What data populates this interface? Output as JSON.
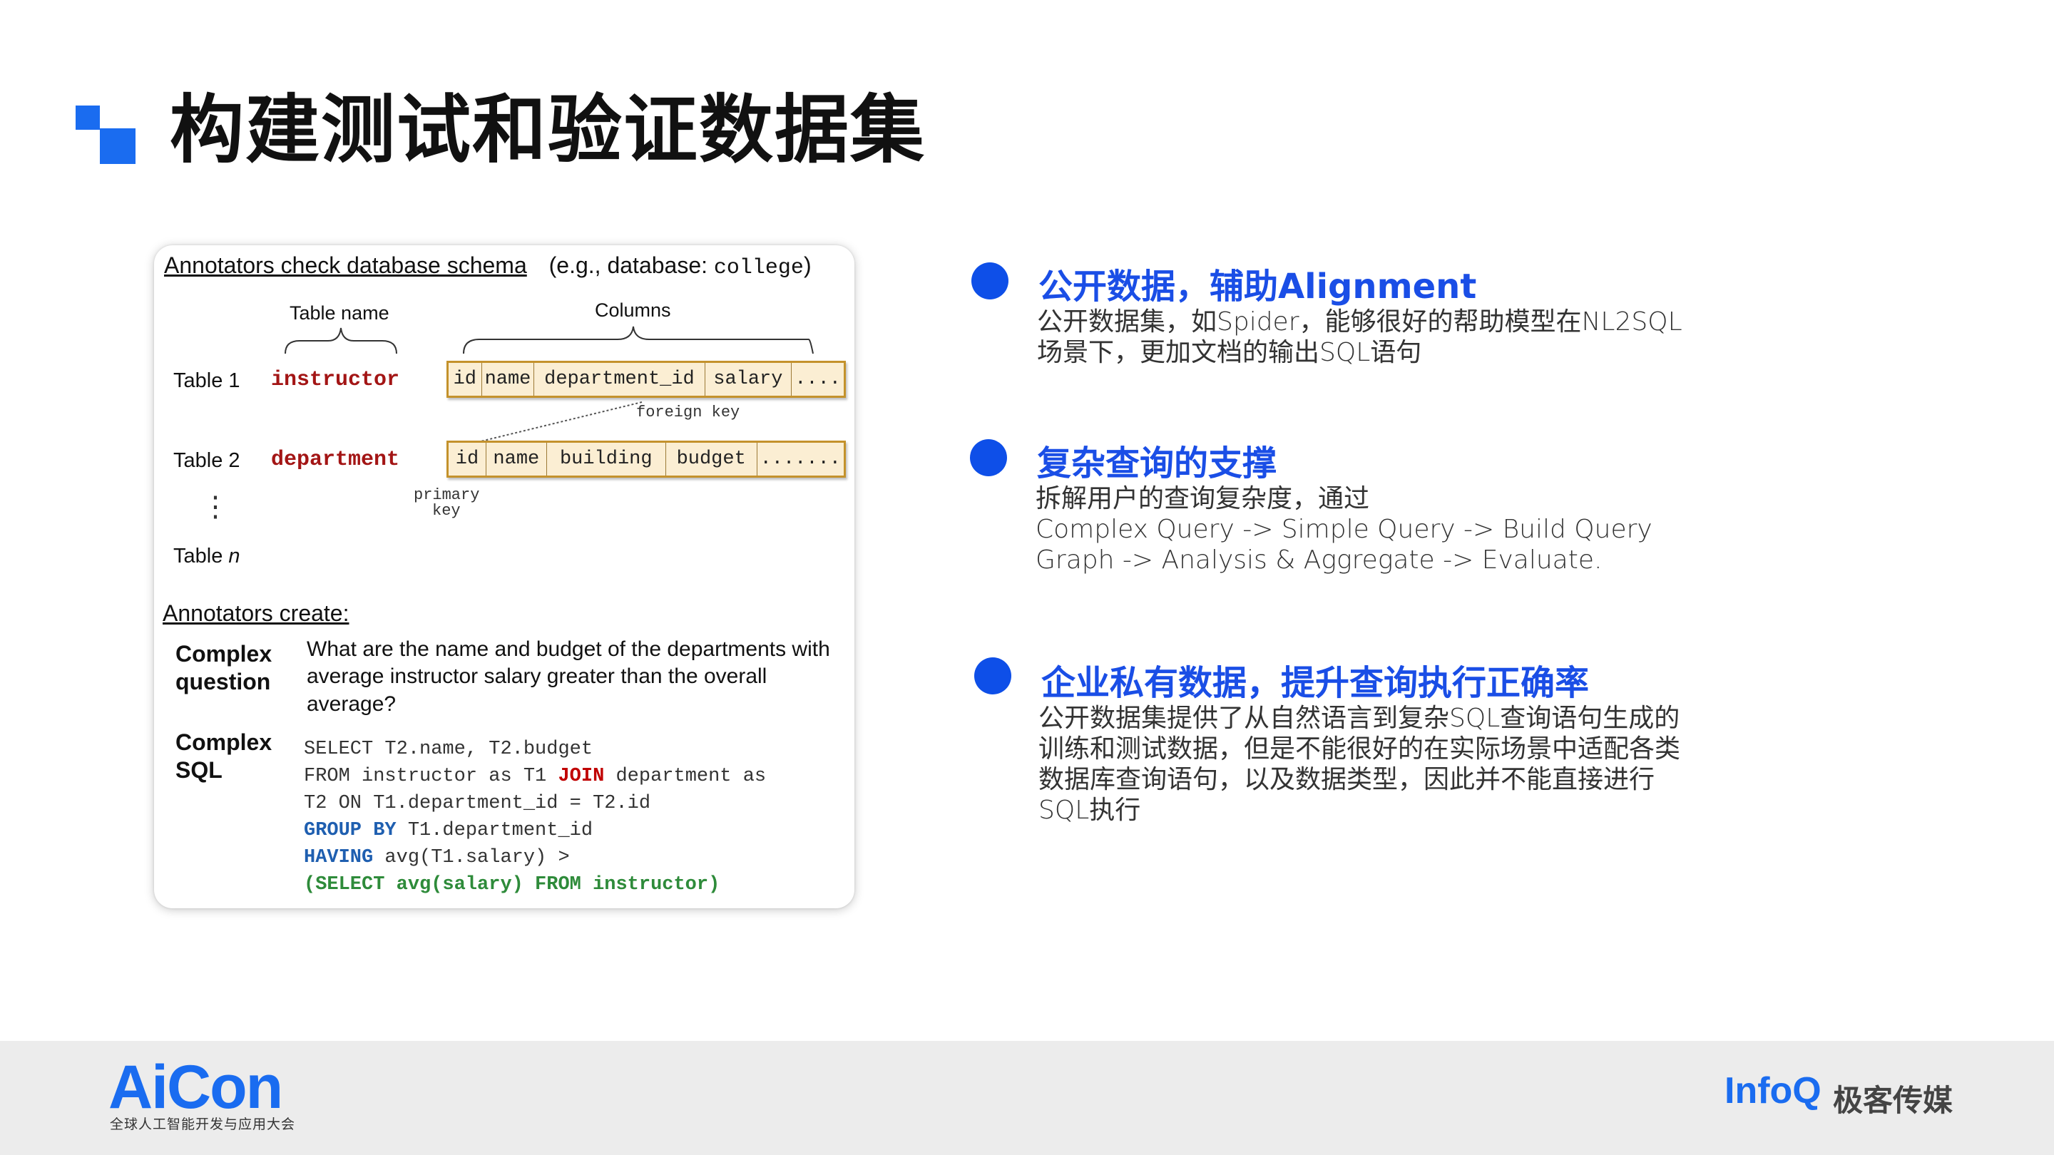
{
  "title": "构建测试和验证数据集",
  "figure": {
    "header": "Annotators check database schema",
    "header_example_prefix": "(e.g., database: ",
    "header_example_db": "college",
    "header_example_suffix": ")",
    "table_name_label": "Table name",
    "columns_label": "Columns",
    "tables": [
      {
        "label": "Table 1",
        "name": "instructor",
        "columns": [
          "id",
          "name",
          "department_id",
          "salary",
          "...."
        ]
      },
      {
        "label": "Table 2",
        "name": "department",
        "columns": [
          "id",
          "name",
          "building",
          "budget",
          "......."
        ]
      }
    ],
    "table_n_prefix": "Table ",
    "table_n_var": "n",
    "foreign_key_label": "foreign key",
    "primary_key_label_1": "primary",
    "primary_key_label_2": "key",
    "vertical_dots": "⋮",
    "create_header": "Annotators create:",
    "question_label_1": "Complex",
    "question_label_2": "question",
    "question_text": "What are the name and budget of the departments with average instructor salary greater than the overall average?",
    "sql_label_1": "Complex",
    "sql_label_2": "SQL",
    "sql": {
      "l1": "SELECT T2.name, T2.budget",
      "l2_a": "FROM instructor as T1 ",
      "l2_kw": "JOIN",
      "l2_b": " department as",
      "l3": "T2 ON T1.department_id = T2.id",
      "l4_kw": "GROUP BY",
      "l4_b": " T1.department_id",
      "l5_kw": "HAVING",
      "l5_b": " avg(T1.salary) >",
      "l6": "    (SELECT avg(salary) FROM instructor)"
    }
  },
  "bullets": [
    {
      "title": "公开数据，辅助Alignment",
      "lines": [
        "公开数据集，如Spider，能够很好的帮助模型在NL2SQL",
        "场景下，更加文档的输出SQL语句"
      ]
    },
    {
      "title": "复杂查询的支撑",
      "lines": [
        "拆解用户的查询复杂度，通过",
        "Complex Query -> Simple Query -> Build Query",
        "Graph -> Analysis & Aggregate -> Evaluate."
      ]
    },
    {
      "title": "企业私有数据，提升查询执行正确率",
      "lines": [
        "公开数据集提供了从自然语言到复杂SQL查询语句生成的",
        "训练和测试数据，但是不能很好的在实际场景中适配各类",
        "数据库查询语句，以及数据类型，因此并不能直接进行",
        "SQL执行"
      ]
    }
  ],
  "footer": {
    "aicon_logo": "AiCon",
    "aicon_subtitle": "全球人工智能开发与应用大会",
    "infoq_logo": "InfoQ",
    "infoq_cn": "极客传媒"
  },
  "colors": {
    "accent": "#1a6cf0",
    "bullet_title": "#1a4ee6",
    "table_name": "#a31515",
    "schema_fill": "#fbeed3",
    "schema_border": "#c4922c"
  }
}
